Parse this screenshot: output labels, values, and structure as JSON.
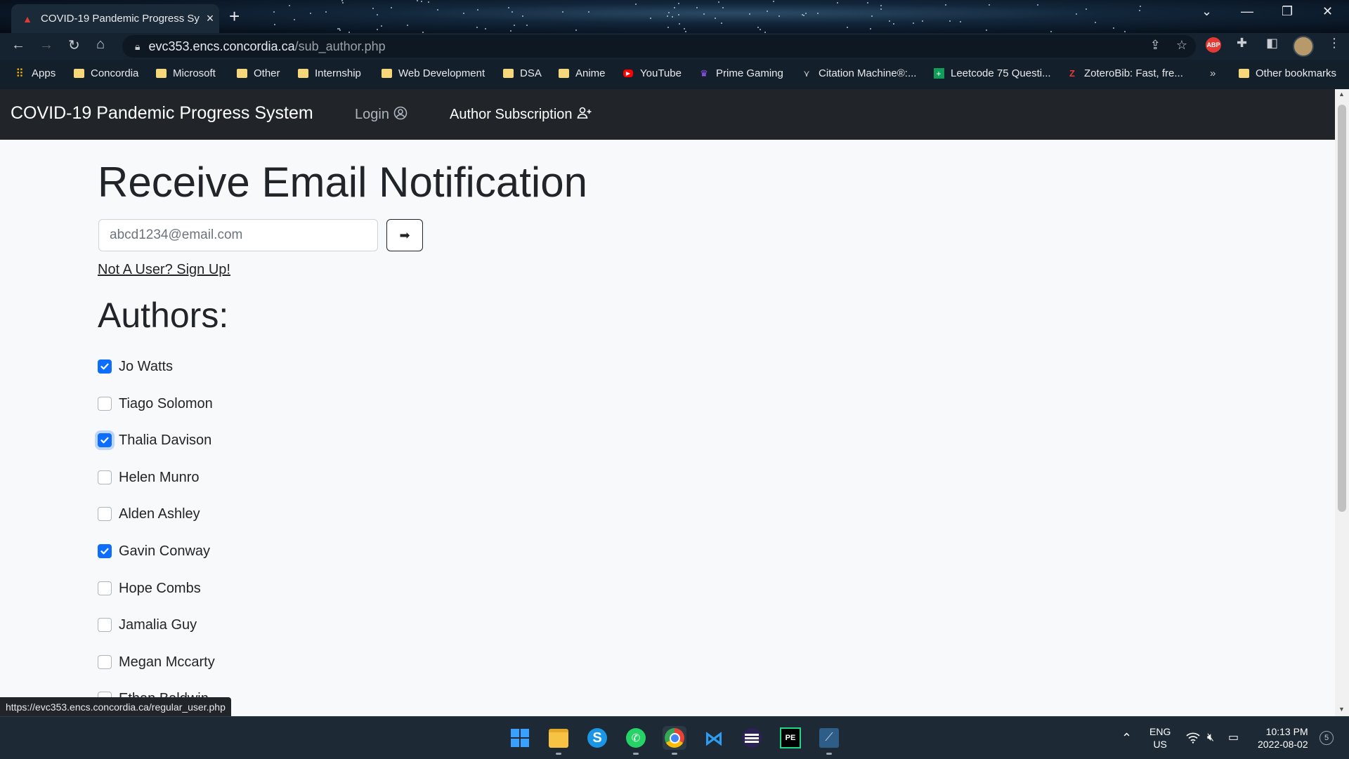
{
  "browser": {
    "tab_title": "COVID-19 Pandemic Progress Sy",
    "new_tab": "+",
    "url_host": "evc353.encs.concordia.ca",
    "url_path": "/sub_author.php",
    "window_controls": {
      "chevron": "⌄",
      "minimize": "—",
      "restore": "❐",
      "close": "✕"
    },
    "bookmarks": [
      {
        "label": "Apps",
        "icon": "apps-grid-icon"
      },
      {
        "label": "Concordia",
        "icon": "folder-icon"
      },
      {
        "label": "Microsoft",
        "icon": "folder-icon"
      },
      {
        "label": "Other",
        "icon": "folder-icon"
      },
      {
        "label": "Internship",
        "icon": "folder-icon"
      },
      {
        "label": "Web Development",
        "icon": "folder-icon"
      },
      {
        "label": "DSA",
        "icon": "folder-icon"
      },
      {
        "label": "Anime",
        "icon": "folder-icon"
      },
      {
        "label": "YouTube",
        "icon": "youtube-icon"
      },
      {
        "label": "Prime Gaming",
        "icon": "crown-icon"
      },
      {
        "label": "Citation Machine®:...",
        "icon": "citation-icon"
      },
      {
        "label": "Leetcode 75 Questi...",
        "icon": "plus-sheet-icon"
      },
      {
        "label": "ZoteroBib: Fast, fre...",
        "icon": "zotero-icon"
      }
    ],
    "bookmarks_overflow": "»",
    "other_bookmarks": "Other bookmarks",
    "abp_label": "ABP"
  },
  "navbar": {
    "brand": "COVID-19 Pandemic Progress System",
    "login": "Login",
    "author_subscription": "Author Subscription"
  },
  "form": {
    "heading": "Receive Email Notification",
    "email_placeholder": "abcd1234@email.com",
    "email_value": "",
    "submit_glyph": "➡",
    "signup_link": "Not A User? Sign Up!"
  },
  "authors": {
    "heading": "Authors:",
    "items": [
      {
        "name": "Jo Watts",
        "checked": true
      },
      {
        "name": "Tiago Solomon",
        "checked": false
      },
      {
        "name": "Thalia Davison",
        "checked": true,
        "focused": true
      },
      {
        "name": "Helen Munro",
        "checked": false
      },
      {
        "name": "Alden Ashley",
        "checked": false
      },
      {
        "name": "Gavin Conway",
        "checked": true
      },
      {
        "name": "Hope Combs",
        "checked": false
      },
      {
        "name": "Jamalia Guy",
        "checked": false
      },
      {
        "name": "Megan Mccarty",
        "checked": false
      },
      {
        "name": "Ethan Baldwin",
        "checked": false
      }
    ]
  },
  "status_bar": {
    "hover_url": "https://evc353.encs.concordia.ca/regular_user.php"
  },
  "taskbar": {
    "apps": [
      "windows-start-icon",
      "file-explorer-icon",
      "skype-icon",
      "whatsapp-icon",
      "chrome-icon",
      "vscode-icon",
      "eclipse-icon",
      "pycharm-icon",
      "mysql-workbench-icon"
    ],
    "lang_top": "ENG",
    "lang_bottom": "US",
    "time": "10:13 PM",
    "date": "2022-08-02",
    "notification_count": "5"
  },
  "colors": {
    "navbar_bg": "#212529",
    "page_bg": "#f8f9fa",
    "checkbox_checked": "#0d6efd"
  }
}
